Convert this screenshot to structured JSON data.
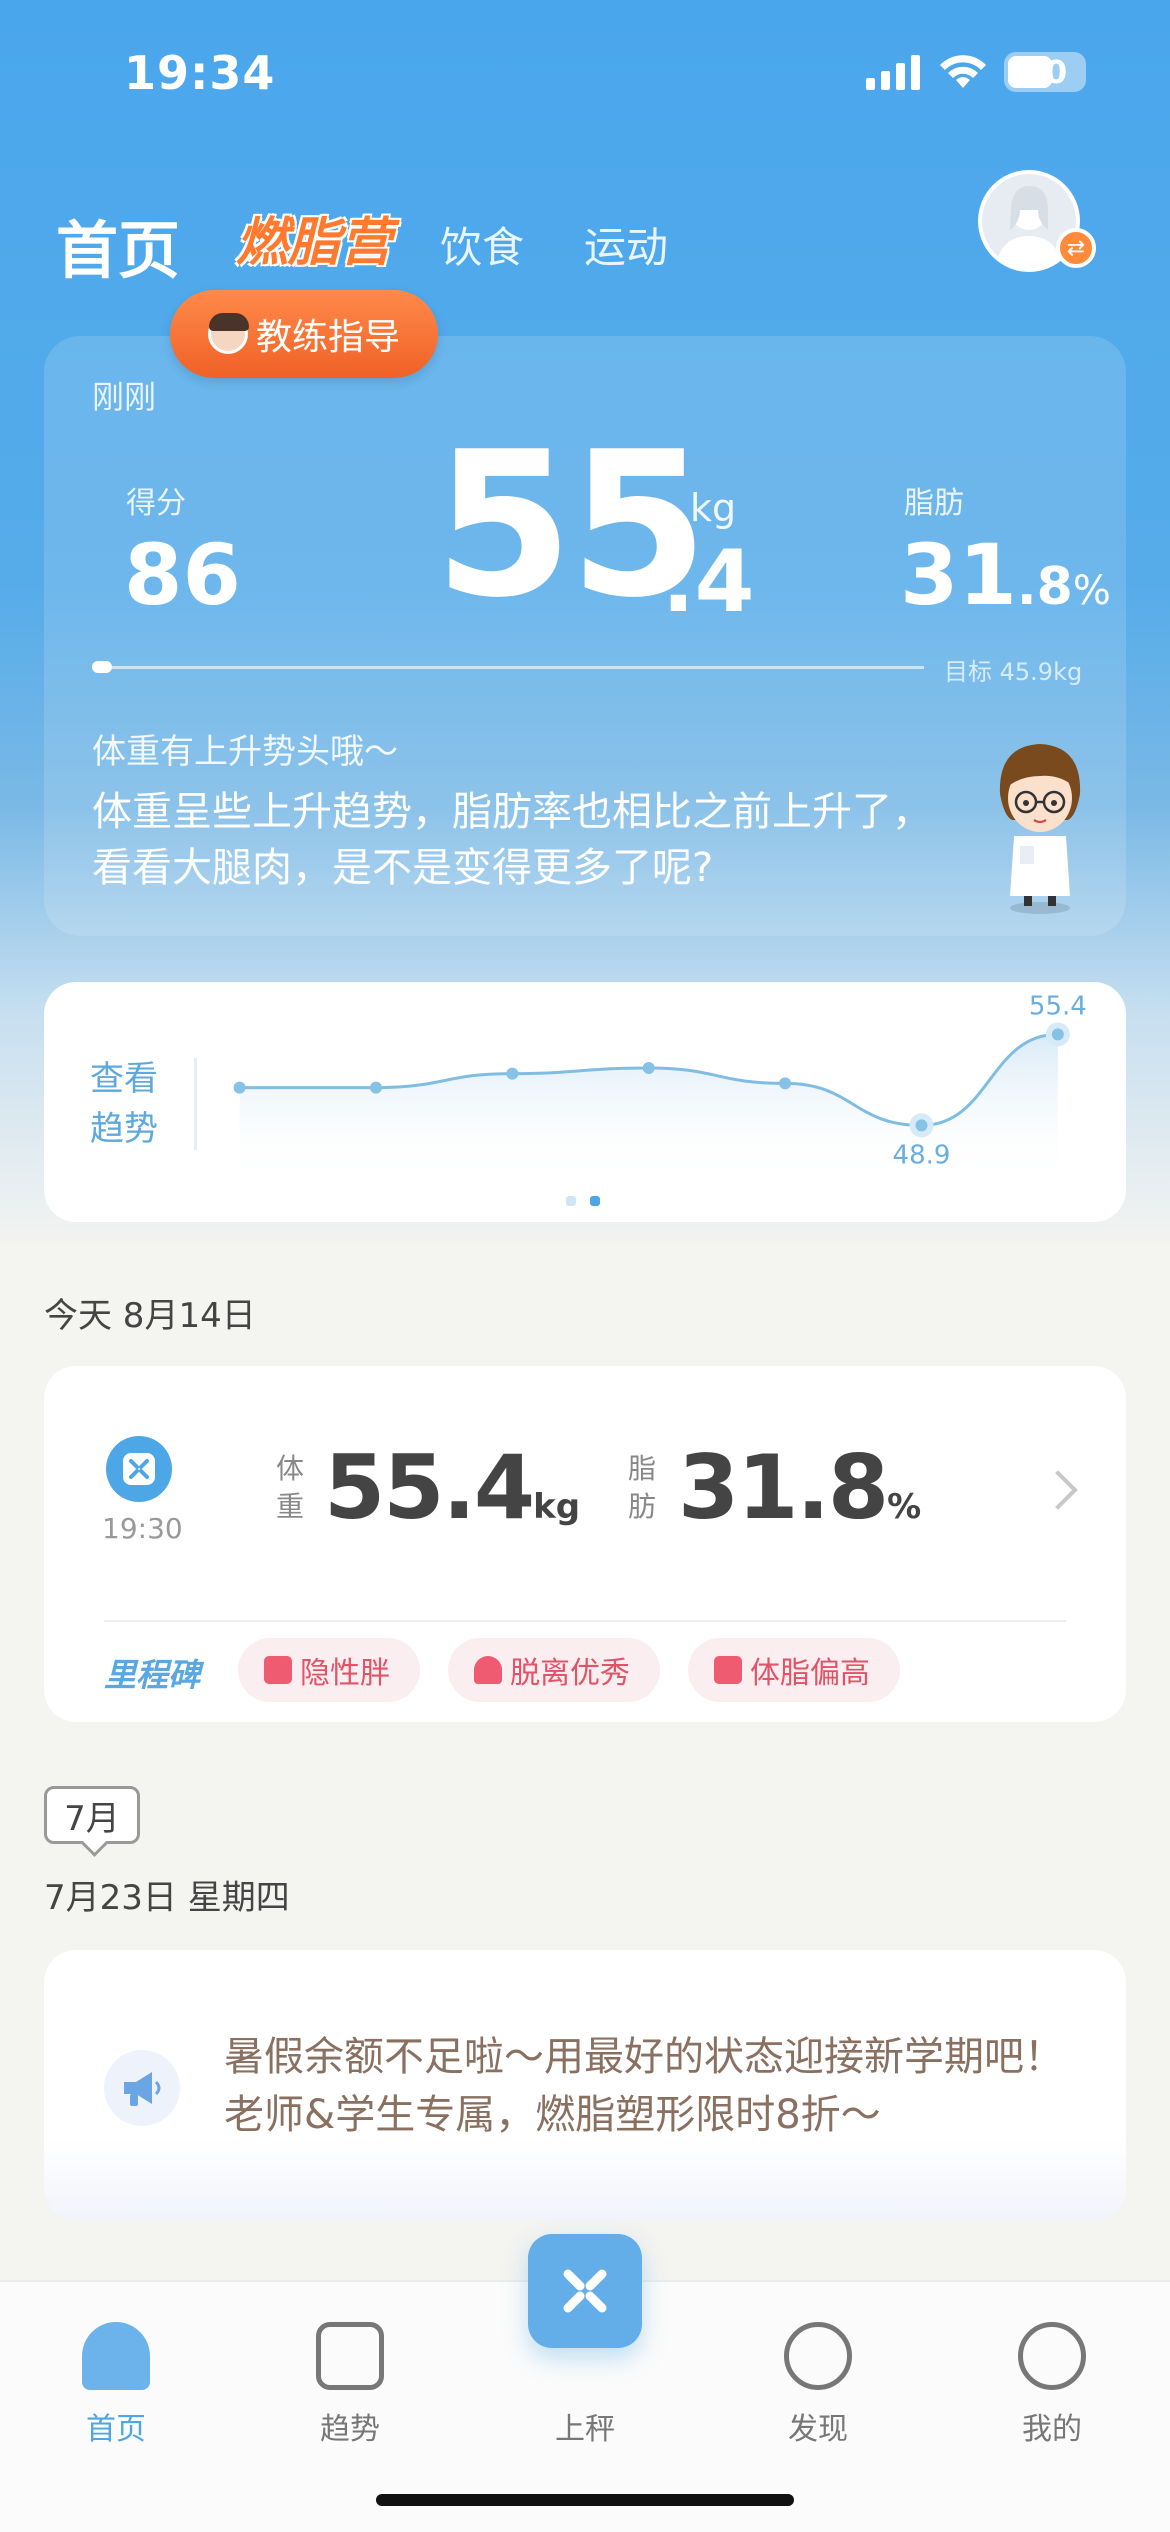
{
  "status_bar": {
    "time": "19:34",
    "battery": "50"
  },
  "nav": {
    "home": "首页",
    "camp": "燃脂营",
    "diet": "饮食",
    "sport": "运动"
  },
  "coach": {
    "label": "教练指导"
  },
  "weight_card": {
    "time": "刚刚",
    "score_label": "得分",
    "score": "86",
    "weight_int": "55",
    "weight_dec": ".4",
    "weight_unit": "kg",
    "fat_label": "脂肪",
    "fat_int": "31",
    "fat_dec": ".8",
    "fat_unit": "%",
    "target": "目标 45.9kg",
    "progress_fraction": 0.02,
    "tip_title": "体重有上升势头哦～",
    "tip_text": "体重呈些上升趋势，脂肪率也相比之前上升了，看看大腿肉，是不是变得更多了呢?"
  },
  "trend": {
    "label": "查看趋势",
    "pager_active": 1
  },
  "chart_data": {
    "type": "line",
    "x": [
      1,
      2,
      3,
      4,
      5,
      6,
      7
    ],
    "values": [
      51.6,
      51.6,
      52.6,
      53.0,
      51.9,
      48.9,
      55.4
    ],
    "labels": {
      "min": "48.9",
      "max": "55.4"
    },
    "ylim": [
      47,
      57
    ],
    "grid": false
  },
  "today": {
    "date": "今天 8月14日",
    "time": "19:30",
    "weight_label": "体重",
    "weight": "55.4",
    "weight_unit": "kg",
    "fat_label": "脂肪",
    "fat": "31.8",
    "fat_unit": "%",
    "milestone": "里程碑",
    "tags": [
      "隐性胖",
      "脱离优秀",
      "体脂偏高"
    ]
  },
  "july": {
    "month": "7月",
    "date": "7月23日 星期四",
    "promo": "暑假余额不足啦～用最好的状态迎接新学期吧！老师&学生专属，燃脂塑形限时8折～"
  },
  "tab_bar": {
    "home": "首页",
    "trend": "趋势",
    "scale": "上秤",
    "find": "发现",
    "mine": "我的"
  },
  "colors": {
    "accent": "#4da6e6",
    "orange": "#f06126",
    "tag_red": "#e25367"
  }
}
